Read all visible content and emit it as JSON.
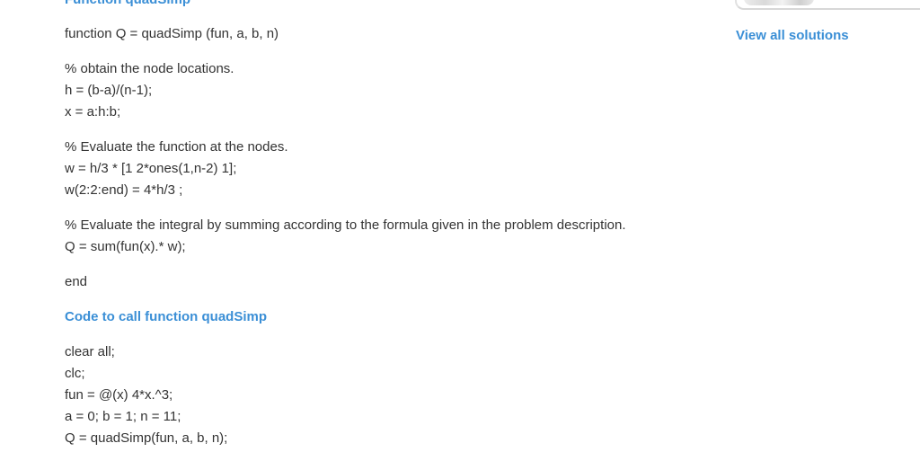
{
  "solution": {
    "cut_heading": "Function quadSimp",
    "function_code": [
      [
        "function Q = quadSimp (fun, a, b, n)"
      ],
      [
        "% obtain the node locations.",
        "h = (b-a)/(n-1);",
        "x = a:h:b;"
      ],
      [
        "% Evaluate the function at the nodes.",
        "w = h/3 * [1 2*ones(1,n-2) 1];",
        "w(2:2:end) = 4*h/3 ;"
      ],
      [
        "% Evaluate the integral by summing according to the formula given in the problem description.",
        "Q = sum(fun(x).* w);"
      ],
      [
        "end"
      ]
    ],
    "call_heading": "Code to call function quadSimp",
    "call_code": [
      "clear all;",
      "clc;",
      "fun = @(x) 4*x.^3;",
      "a = 0; b = 1; n = 11;",
      "Q = quadSimp(fun, a, b, n);"
    ]
  },
  "sidebar": {
    "view_all_label": "View all solutions"
  },
  "colors": {
    "link": "#3b8fd6",
    "text": "#333333"
  }
}
